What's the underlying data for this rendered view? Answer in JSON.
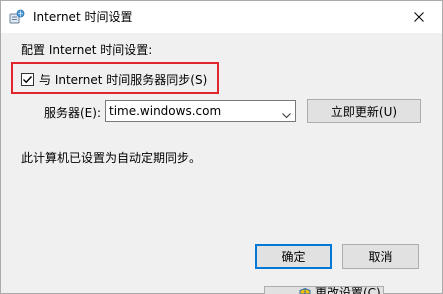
{
  "window": {
    "title": "Internet 时间设置",
    "icon": "clock-globe-icon"
  },
  "content": {
    "heading": "配置 Internet 时间设置:",
    "sync_checkbox": {
      "label": "与 Internet 时间服务器同步(S)",
      "checked": true
    },
    "server_label": "服务器(E):",
    "server_value": "time.windows.com",
    "update_button": "立即更新(U)",
    "status_text": "此计算机已设置为自动定期同步。"
  },
  "buttons": {
    "ok": "确定",
    "cancel": "取消"
  },
  "background_window": {
    "change_settings_button": "更改设置(C)"
  },
  "colors": {
    "highlight_border": "#e0262c",
    "dialog_body": "#f0f0f0",
    "default_button_border": "#0078d7"
  }
}
